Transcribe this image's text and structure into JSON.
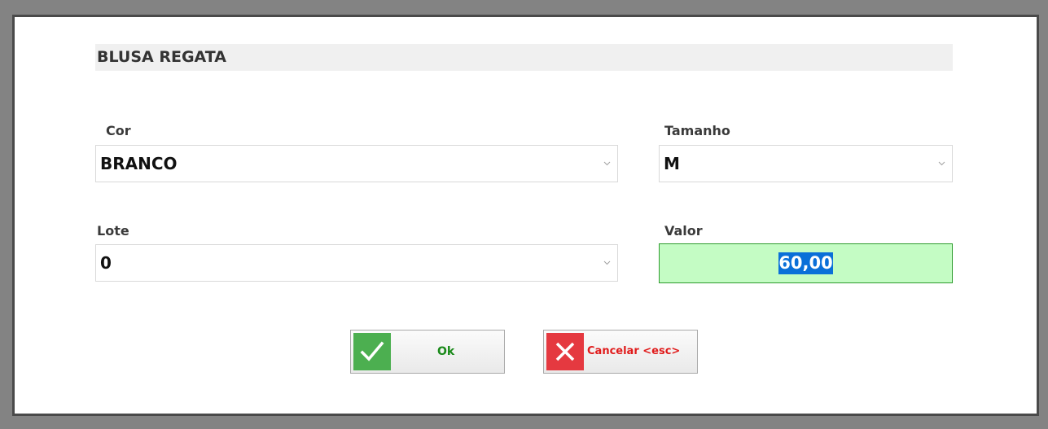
{
  "dialog": {
    "title": "BLUSA REGATA"
  },
  "fields": {
    "cor": {
      "label": "Cor",
      "value": "BRANCO"
    },
    "tamanho": {
      "label": "Tamanho",
      "value": "M"
    },
    "lote": {
      "label": "Lote",
      "value": "0"
    },
    "valor": {
      "label": "Valor",
      "value": "60,00"
    }
  },
  "buttons": {
    "ok": {
      "label": "Ok",
      "icon": "check-icon",
      "color": "#1a8a1a",
      "icon_bg": "#4caf50"
    },
    "cancel": {
      "label": "Cancelar <esc>",
      "icon": "close-icon",
      "color": "#e01b1b",
      "icon_bg": "#e53940"
    }
  },
  "colors": {
    "valor_bg": "#c4fcc4",
    "selection": "#0a6fd8"
  }
}
